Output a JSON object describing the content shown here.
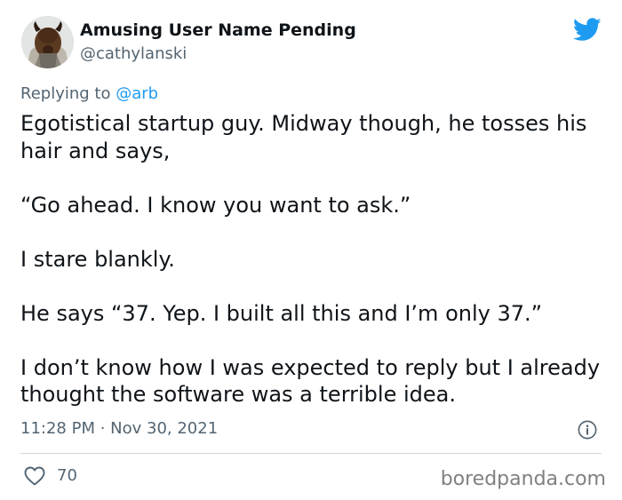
{
  "tweet": {
    "display_name": "Amusing User Name Pending",
    "handle": "@cathylanski",
    "replying_prefix": "Replying to ",
    "replying_to": "@arb",
    "paragraphs": [
      "Egotistical startup guy. Midway though, he tosses his hair and says,",
      "“Go ahead. I know you want to ask.”",
      "I stare blankly.",
      "He says “37. Yep. I built all this and I’m only 37.”",
      "I don’t know how I was expected to reply but I already thought the software was a terrible idea."
    ],
    "timestamp": "11:28 PM · Nov 30, 2021",
    "like_count": "70"
  },
  "icons": {
    "brand": "twitter-bird-icon",
    "info": "info-icon",
    "like": "heart-icon",
    "avatar": "user-avatar"
  },
  "colors": {
    "twitter_blue": "#1d9bf0",
    "secondary_text": "#536471",
    "primary_text": "#0f1419",
    "divider": "#cfd9de"
  },
  "watermark": "boredpanda.com"
}
